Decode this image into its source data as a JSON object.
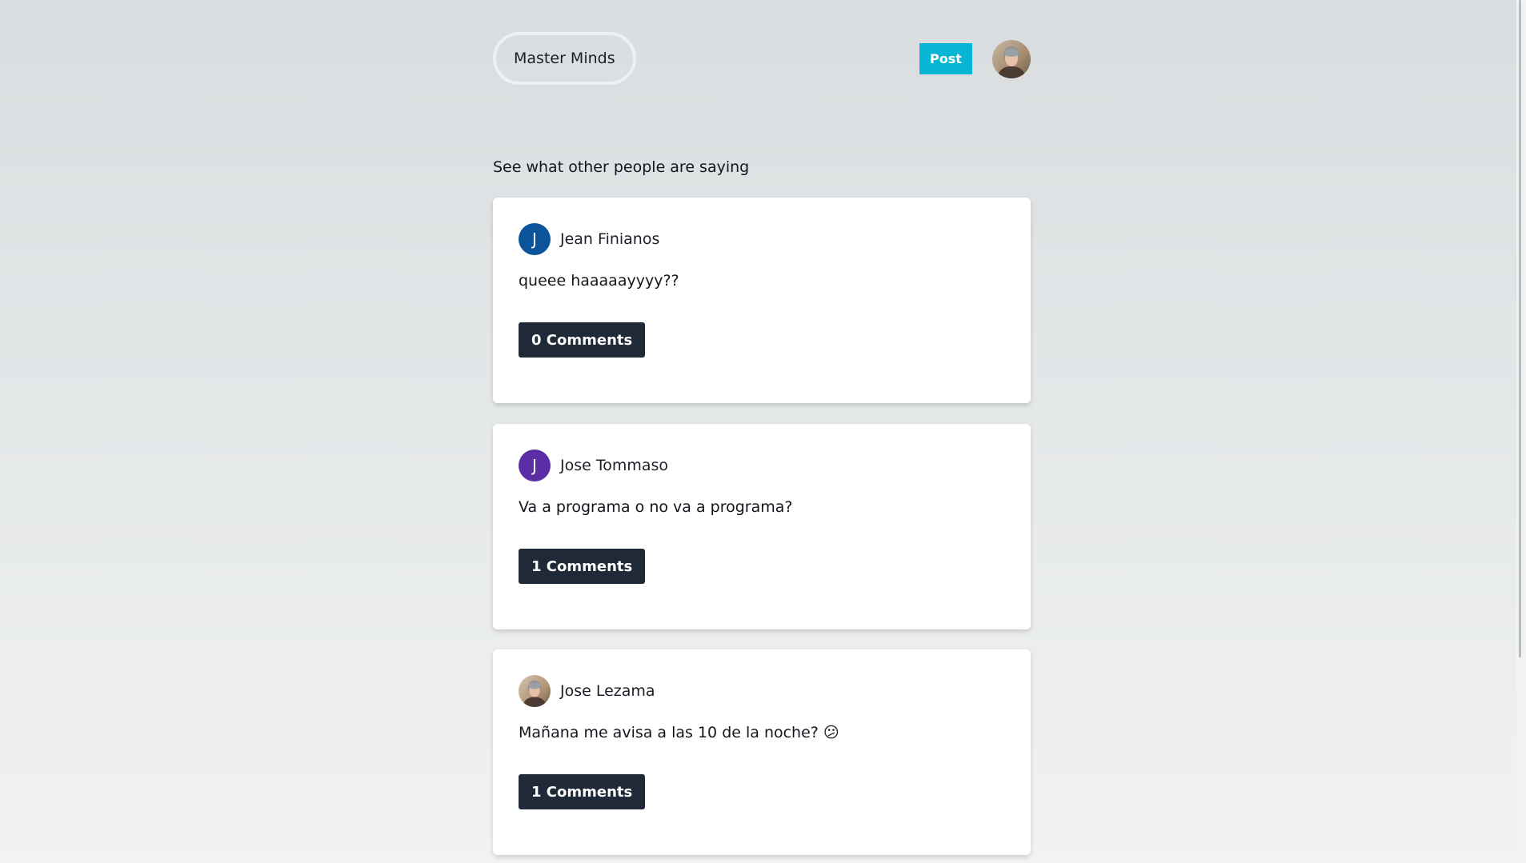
{
  "header": {
    "brand": "Master Minds",
    "post_label": "Post",
    "avatar_icon": "user-photo-avatar"
  },
  "feed": {
    "title": "See what other people are saying",
    "posts": [
      {
        "author": "Jean Finianos",
        "initial": "J",
        "avatar_color": "#0c5499",
        "text": "queee haaaaayyyy??",
        "comments_label": "0 Comments"
      },
      {
        "author": "Jose Tommaso",
        "initial": "J",
        "avatar_color": "#5b2ea6",
        "text": "Va a programa o no va a programa?",
        "comments_label": "1 Comments"
      },
      {
        "author": "Jose Lezama",
        "initial": "",
        "avatar_color": "",
        "text": "Mañana me avisa a las 10 de la noche? 😕",
        "comments_label": "1 Comments"
      }
    ]
  },
  "colors": {
    "post_button": "#06b6d4",
    "comments_button": "#1f2937",
    "card_background": "#ffffff"
  }
}
